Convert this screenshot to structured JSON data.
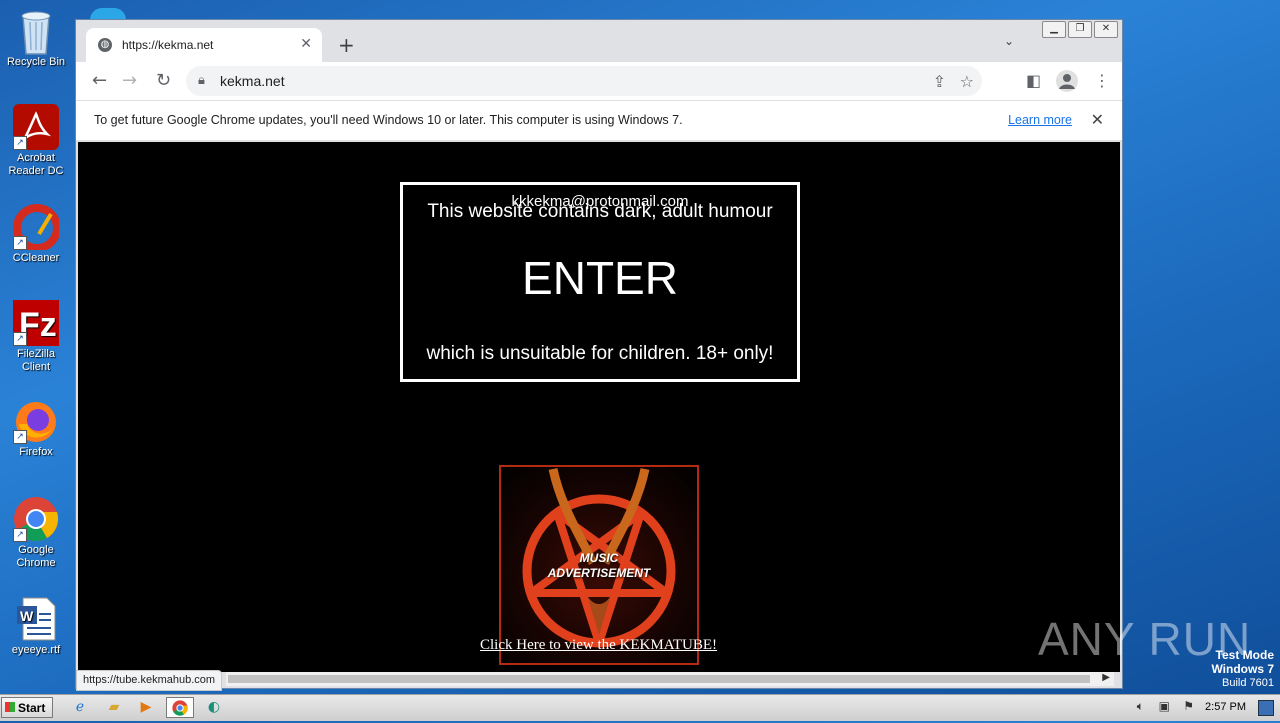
{
  "desktop": {
    "icons": [
      {
        "label": "Recycle Bin",
        "icon": "recycle-bin-icon"
      },
      {
        "label": "Acrobat Reader DC",
        "icon": "acrobat-icon"
      },
      {
        "label": "CCleaner",
        "icon": "ccleaner-icon"
      },
      {
        "label": "FileZilla Client",
        "icon": "filezilla-icon"
      },
      {
        "label": "Firefox",
        "icon": "firefox-icon"
      },
      {
        "label": "Google Chrome",
        "icon": "chrome-icon"
      },
      {
        "label": "eyeeye.rtf",
        "icon": "word-document-icon"
      }
    ]
  },
  "browser": {
    "tab": {
      "title": "https://kekma.net",
      "close": "✕"
    },
    "new_tab": "+",
    "address": "kekma.net",
    "infobar": {
      "message": "To get future Google Chrome updates, you'll need Windows 10 or later. This computer is using Windows 7.",
      "learn_more": "Learn more",
      "close": "✕"
    },
    "status_url": "https://tube.kekmahub.com"
  },
  "page": {
    "email": "kkkekma@protonmail.com",
    "warning_line1": "This website contains dark, adult humour",
    "enter": "ENTER",
    "warning_line2": "which is unsuitable for children. 18+ only!",
    "promo_label_1": "MUSIC",
    "promo_label_2": "ADVERTISEMENT",
    "link_text": "Click Here to view the KEKMATUBE!"
  },
  "watermark": {
    "brand": "ANY RUN",
    "test_mode": "Test Mode",
    "os": "Windows 7",
    "build": "Build 7601"
  },
  "taskbar": {
    "start": "Start",
    "clock": "2:57 PM"
  },
  "colors": {
    "desktop": "#1f6fc5",
    "page_bg": "#000000",
    "link_blue": "#1a73e8",
    "pentagram_red": "#e0401c"
  }
}
